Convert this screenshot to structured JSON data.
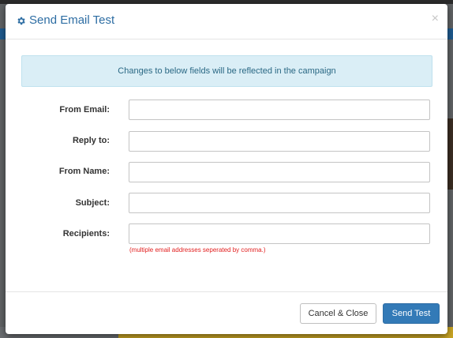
{
  "modal": {
    "title": "Send Email Test",
    "title_icon": "gear-icon",
    "close_label": "×",
    "accent_color": "#2d6da3"
  },
  "info": {
    "message": "Changes to below fields will be reflected in the campaign"
  },
  "form": {
    "from_email": {
      "label": "From Email:",
      "value": "",
      "placeholder": ""
    },
    "reply_to": {
      "label": "Reply to:",
      "value": "",
      "placeholder": ""
    },
    "from_name": {
      "label": "From Name:",
      "value": "",
      "placeholder": ""
    },
    "subject": {
      "label": "Subject:",
      "value": "",
      "placeholder": ""
    },
    "recipients": {
      "label": "Recipients:",
      "value": "",
      "placeholder": "",
      "help": "(multiple email addresses seperated by comma.)"
    }
  },
  "footer": {
    "cancel_label": "Cancel & Close",
    "send_label": "Send Test",
    "send_color": "#337ab7"
  }
}
